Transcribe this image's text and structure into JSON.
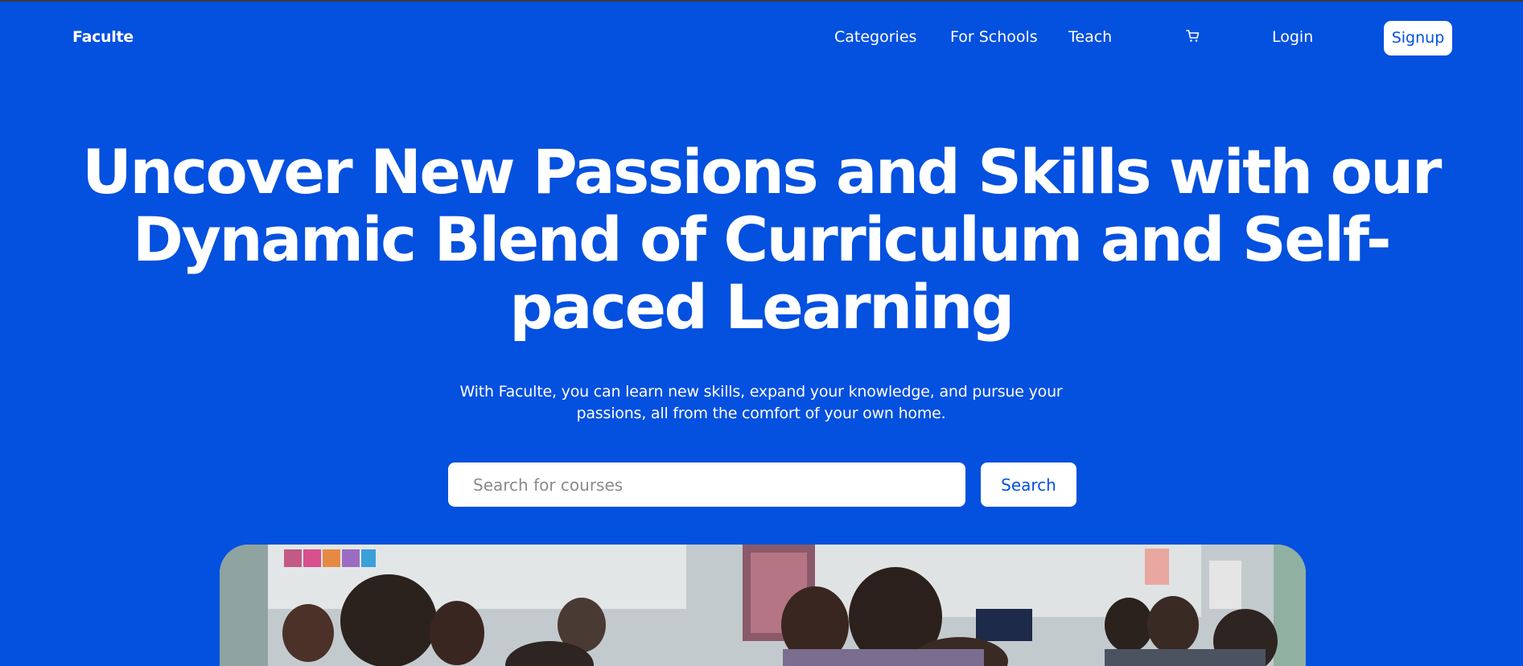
{
  "nav": {
    "brand": "Faculte",
    "links": [
      "Categories",
      "For Schools",
      "Teach"
    ],
    "cart_icon": "cart-icon",
    "login": "Login",
    "signup": "Signup"
  },
  "hero": {
    "title": "Uncover New Passions and Skills with our Dynamic Blend of Curriculum and Self-paced Learning",
    "subtitle": "With Faculte, you can learn new skills, expand your knowledge, and pursue your passions, all from the comfort of your own home.",
    "search_placeholder": "Search for courses",
    "search_button": "Search"
  },
  "colors": {
    "background": "#0450df",
    "accent_text": "#0450df",
    "text": "#ffffff"
  }
}
